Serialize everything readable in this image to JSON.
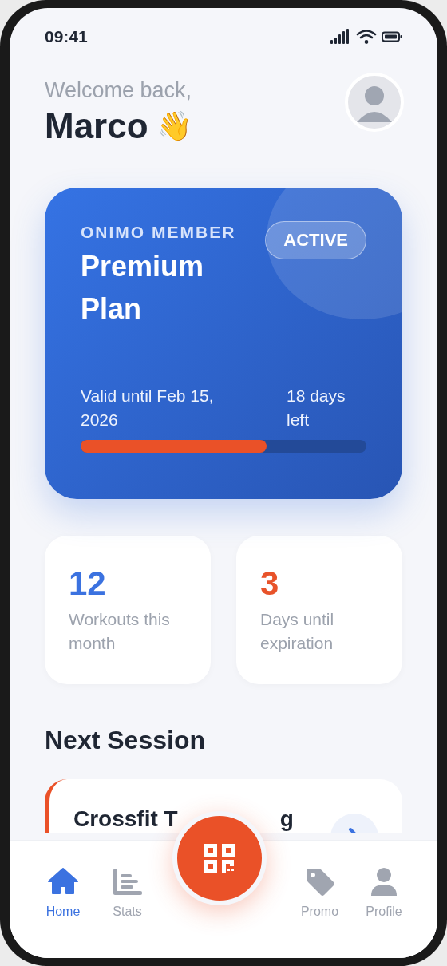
{
  "status_bar": {
    "time": "09:41"
  },
  "header": {
    "greeting": "Welcome back,",
    "name": "Marco",
    "emoji": "👋"
  },
  "membership": {
    "label": "ONIMO MEMBER",
    "plan": "Premium Plan",
    "status": "ACTIVE",
    "validity": "Valid until Feb 15, 2026",
    "remaining": "18 days left",
    "level": 0.65
  },
  "stats": [
    {
      "value": "12",
      "label": "Workouts this month",
      "color": "#3b72e0"
    },
    {
      "value": "3",
      "label": "Days until expiration",
      "color": "#e8532a"
    }
  ],
  "next_session": {
    "heading": "Next Session",
    "title_parts": [
      "Crossfit T",
      "g"
    ]
  },
  "nav": {
    "items": [
      {
        "label": "Home",
        "selected": true
      },
      {
        "label": "Stats",
        "selected": false
      },
      {
        "label": "Promo",
        "selected": false
      },
      {
        "label": "Profile",
        "selected": false
      }
    ]
  }
}
